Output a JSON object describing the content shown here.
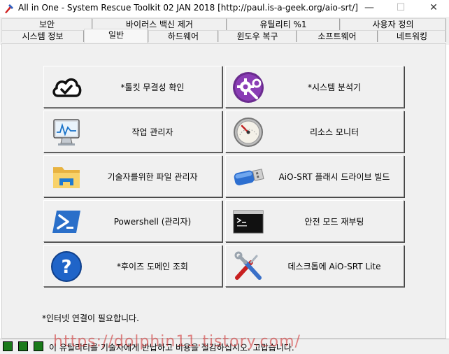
{
  "window": {
    "title": "All in One - System Rescue Toolkit 02 JAN 2018 [http://paul.is-a-geek.org/aio-srt/]",
    "minimize_label": "—",
    "maximize_label": "☐",
    "close_label": "✕"
  },
  "tabs": {
    "row1": [
      {
        "label": "보안"
      },
      {
        "label": "바이러스 백신 제거"
      },
      {
        "label": "유틸리티 %1"
      },
      {
        "label": "사용자 정의"
      }
    ],
    "row2": [
      {
        "label": "시스템 정보"
      },
      {
        "label": "일반",
        "active": true
      },
      {
        "label": "하드웨어"
      },
      {
        "label": "윈도우 복구"
      },
      {
        "label": "소프트웨어"
      },
      {
        "label": "네트워킹"
      }
    ]
  },
  "tools": [
    {
      "label": "*툴킷 무결성 확인",
      "icon": "cloud-check-icon"
    },
    {
      "label": "*시스템 분석기",
      "icon": "gear-wrench-icon"
    },
    {
      "label": "작업 관리자",
      "icon": "monitor-chart-icon"
    },
    {
      "label": "리소스 모니터",
      "icon": "gauge-icon"
    },
    {
      "label": "기술자를위한 파일 관리자",
      "icon": "folder-icon"
    },
    {
      "label": "AiO-SRT 플래시 드라이브 빌드",
      "icon": "usb-drive-icon"
    },
    {
      "label": "Powershell (관리자)",
      "icon": "powershell-icon"
    },
    {
      "label": "안전 모드 재부팅",
      "icon": "command-prompt-icon"
    },
    {
      "label": "*후이즈 도메인 조회",
      "icon": "question-icon"
    },
    {
      "label": "데스크톱에 AiO-SRT Lite",
      "icon": "tools-icon"
    }
  ],
  "note": "*인터넷 연결이 필요합니다.",
  "status": {
    "message": "이 유틸리티를 기술자에게 반납하고 비용을 절감하십시오. 고맙습니다."
  },
  "watermark": "https://dolphin11.tistory.com/"
}
